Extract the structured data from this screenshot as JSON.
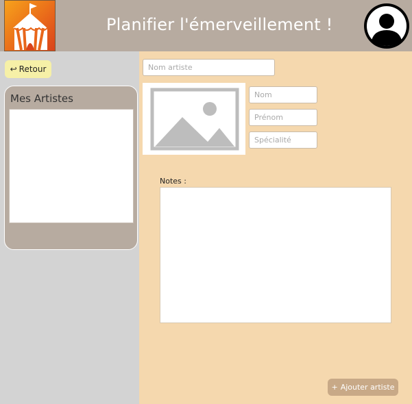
{
  "header": {
    "title": "Planifier l'émerveillement !",
    "logo_icon": "circus-tent-icon",
    "avatar_icon": "user-avatar-icon"
  },
  "sidebar": {
    "back_button": {
      "icon": "↩",
      "label": "Retour"
    },
    "artists_panel": {
      "title": "Mes Artistes",
      "items": []
    }
  },
  "form": {
    "artist_name": {
      "placeholder": "Nom artiste",
      "value": ""
    },
    "last_name": {
      "placeholder": "Nom",
      "value": ""
    },
    "first_name": {
      "placeholder": "Prénom",
      "value": ""
    },
    "specialty": {
      "placeholder": "Spécialité",
      "value": ""
    },
    "photo_icon": "image-placeholder-icon",
    "notes_label": "Notes :",
    "notes_value": ""
  },
  "actions": {
    "add_artist": {
      "icon": "+",
      "label": "Ajouter artiste"
    }
  },
  "colors": {
    "header_bg": "#b7aba0",
    "sidebar_bg": "#d3d3d3",
    "main_bg": "#f5d8ae",
    "back_button_bg": "#f6f0a7",
    "add_button_bg": "#c8a987"
  }
}
